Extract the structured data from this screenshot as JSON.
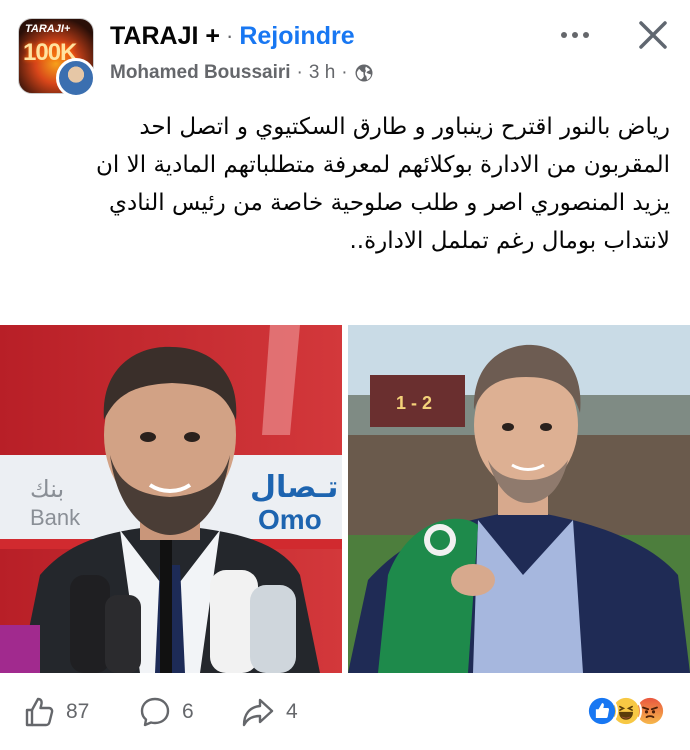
{
  "header": {
    "group_name": "TARAJI +",
    "separator": "·",
    "join_label": "Rejoindre",
    "author": "Mohamed Boussairi",
    "time_separator": "·",
    "time": "3 h",
    "avatar_brand": "TARAJI+",
    "avatar_big": "100K",
    "privacy_icon": "globe-icon",
    "more_icon": "more-icon",
    "close_icon": "close-icon"
  },
  "post": {
    "lines": [
      "رياض بالنور اقترح زينباور و طارق السكتيوي و اتصل احد",
      "المقربون من الادارة بوكلائهم لمعرفة متطلباتهم المادية الا ان",
      "يزيد المنصوري اصر و طلب صلوحية خاصة من رئيس النادي",
      "لانتداب بومال رغم تململ الادارة.."
    ]
  },
  "photos": {
    "left": {
      "board_text_1": "بنك",
      "board_text_2": "Bank",
      "board_text_3": "تـصال",
      "board_text_4": "Omo"
    },
    "right": {
      "scoreboard": "1 - 2"
    }
  },
  "footer": {
    "likes": "87",
    "comments": "6",
    "shares": "4",
    "like_icon": "thumbs-up-icon",
    "comment_icon": "comment-icon",
    "share_icon": "share-icon",
    "reactions": [
      "like-reaction",
      "haha-reaction",
      "angry-reaction"
    ]
  },
  "colors": {
    "link": "#1877f2",
    "secondary_text": "#65676b",
    "primary_text": "#050505"
  }
}
